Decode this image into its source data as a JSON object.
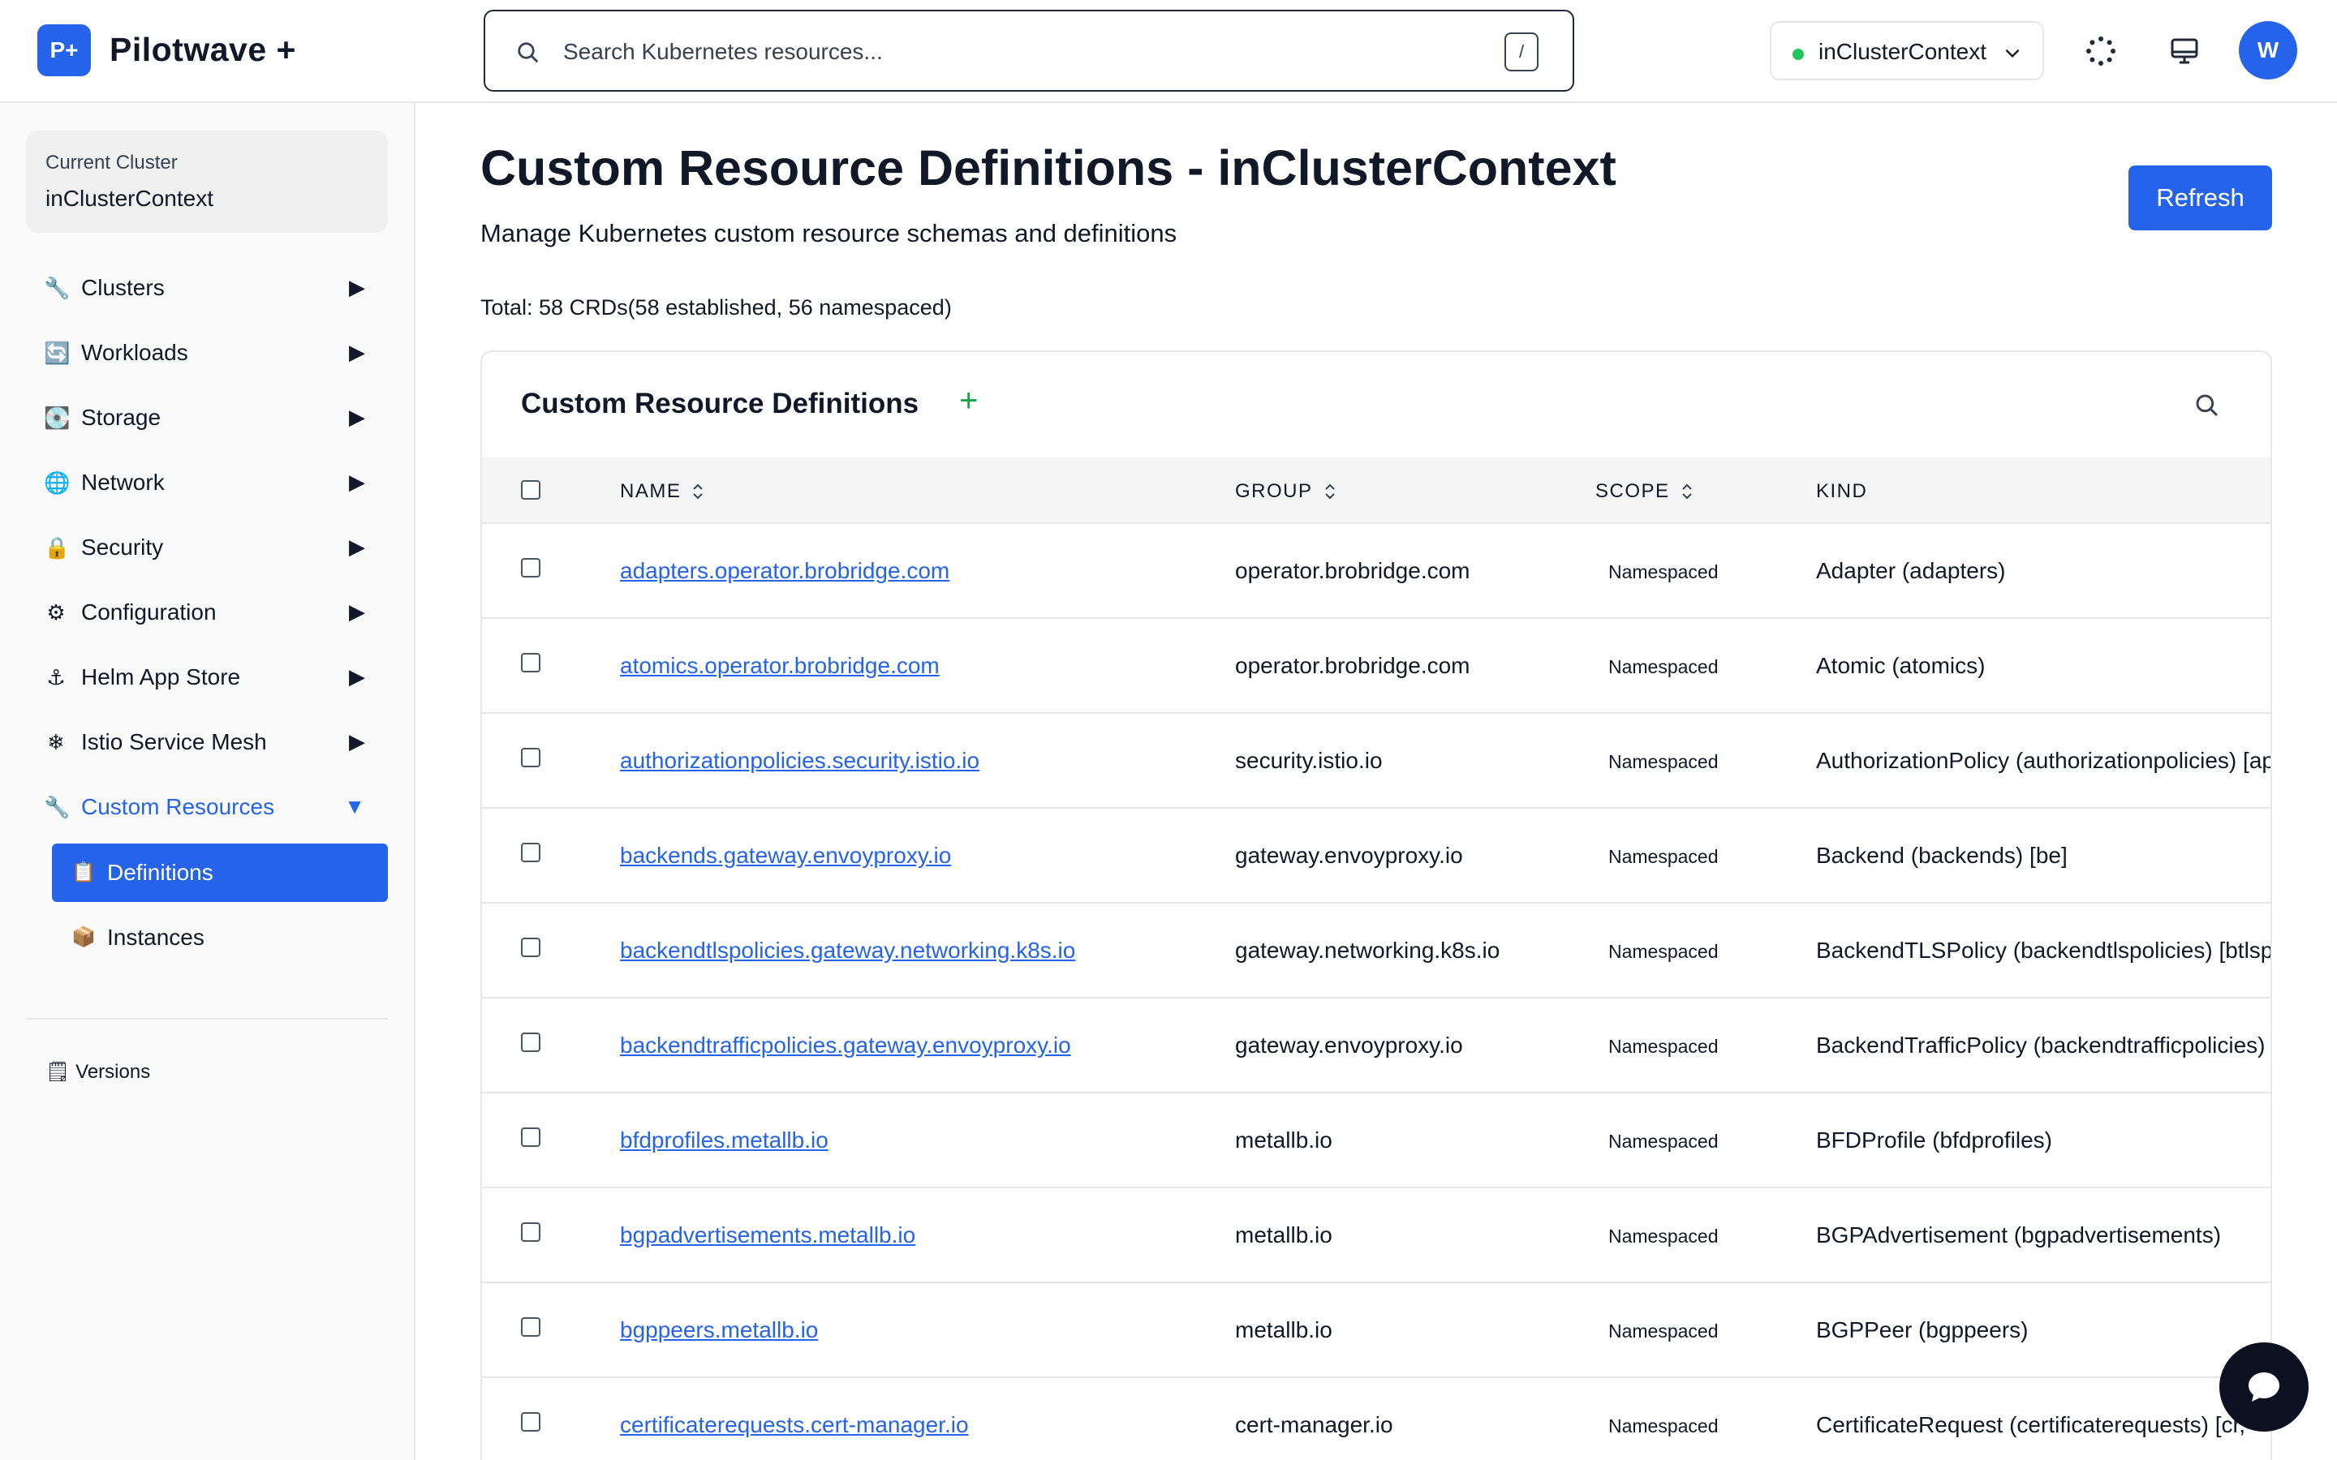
{
  "header": {
    "logo_badge": "P+",
    "app_name": "Pilotwave +",
    "search_placeholder": "Search Kubernetes resources...",
    "search_shortcut": "/",
    "context_selector": "inClusterContext",
    "avatar_initial": "W",
    "status_color": "#22c55e"
  },
  "sidebar": {
    "cluster_label": "Current Cluster",
    "cluster_value": "inClusterContext",
    "items": [
      {
        "label": "Clusters",
        "icon": "wrench-icon",
        "glyph": "🔧",
        "arrow": "▶"
      },
      {
        "label": "Workloads",
        "icon": "cycle-icon",
        "glyph": "🔄",
        "arrow": "▶"
      },
      {
        "label": "Storage",
        "icon": "storage-icon",
        "glyph": "💽",
        "arrow": "▶"
      },
      {
        "label": "Network",
        "icon": "globe-icon",
        "glyph": "🌐",
        "arrow": "▶"
      },
      {
        "label": "Security",
        "icon": "lock-icon",
        "glyph": "🔒",
        "arrow": "▶"
      },
      {
        "label": "Configuration",
        "icon": "gear-icon",
        "glyph": "⚙",
        "arrow": "▶"
      },
      {
        "label": "Helm App Store",
        "icon": "anchor-icon",
        "glyph": "⚓",
        "arrow": "▶"
      },
      {
        "label": "Istio Service Mesh",
        "icon": "mesh-icon",
        "glyph": "❄",
        "arrow": "▶"
      },
      {
        "label": "Custom Resources",
        "icon": "wrench-icon",
        "glyph": "🔧",
        "arrow": "▼"
      }
    ],
    "sub_items": [
      {
        "label": "Definitions",
        "icon": "clipboard-icon",
        "glyph": "📋"
      },
      {
        "label": "Instances",
        "icon": "package-icon",
        "glyph": "📦"
      }
    ],
    "versions": {
      "label": "Versions",
      "glyph": "🗒"
    }
  },
  "main": {
    "title": "Custom Resource Definitions - inClusterContext",
    "subtitle": "Manage Kubernetes custom resource schemas and definitions",
    "refresh_label": "Refresh",
    "summary": "Total: 58 CRDs(58 established, 56 namespaced)",
    "accent_color": "#2563eb"
  },
  "table": {
    "title": "Custom Resource Definitions",
    "add_glyph": "+",
    "columns": [
      "NAME",
      "GROUP",
      "SCOPE",
      "KIND"
    ],
    "rows": [
      {
        "name": "adapters.operator.brobridge.com",
        "group": "operator.brobridge.com",
        "scope": "Namespaced",
        "kind": "Adapter (adapters)"
      },
      {
        "name": "atomics.operator.brobridge.com",
        "group": "operator.brobridge.com",
        "scope": "Namespaced",
        "kind": "Atomic (atomics)"
      },
      {
        "name": "authorizationpolicies.security.istio.io",
        "group": "security.istio.io",
        "scope": "Namespaced",
        "kind": "AuthorizationPolicy (authorizationpolicies) [ap"
      },
      {
        "name": "backends.gateway.envoyproxy.io",
        "group": "gateway.envoyproxy.io",
        "scope": "Namespaced",
        "kind": "Backend (backends) [be]"
      },
      {
        "name": "backendtlspolicies.gateway.networking.k8s.io",
        "group": "gateway.networking.k8s.io",
        "scope": "Namespaced",
        "kind": "BackendTLSPolicy (backendtlspolicies) [btlsp"
      },
      {
        "name": "backendtrafficpolicies.gateway.envoyproxy.io",
        "group": "gateway.envoyproxy.io",
        "scope": "Namespaced",
        "kind": "BackendTrafficPolicy (backendtrafficpolicies)"
      },
      {
        "name": "bfdprofiles.metallb.io",
        "group": "metallb.io",
        "scope": "Namespaced",
        "kind": "BFDProfile (bfdprofiles)"
      },
      {
        "name": "bgpadvertisements.metallb.io",
        "group": "metallb.io",
        "scope": "Namespaced",
        "kind": "BGPAdvertisement (bgpadvertisements)"
      },
      {
        "name": "bgppeers.metallb.io",
        "group": "metallb.io",
        "scope": "Namespaced",
        "kind": "BGPPeer (bgppeers)"
      },
      {
        "name": "certificaterequests.cert-manager.io",
        "group": "cert-manager.io",
        "scope": "Namespaced",
        "kind": "CertificateRequest (certificaterequests) [cr,"
      }
    ]
  }
}
